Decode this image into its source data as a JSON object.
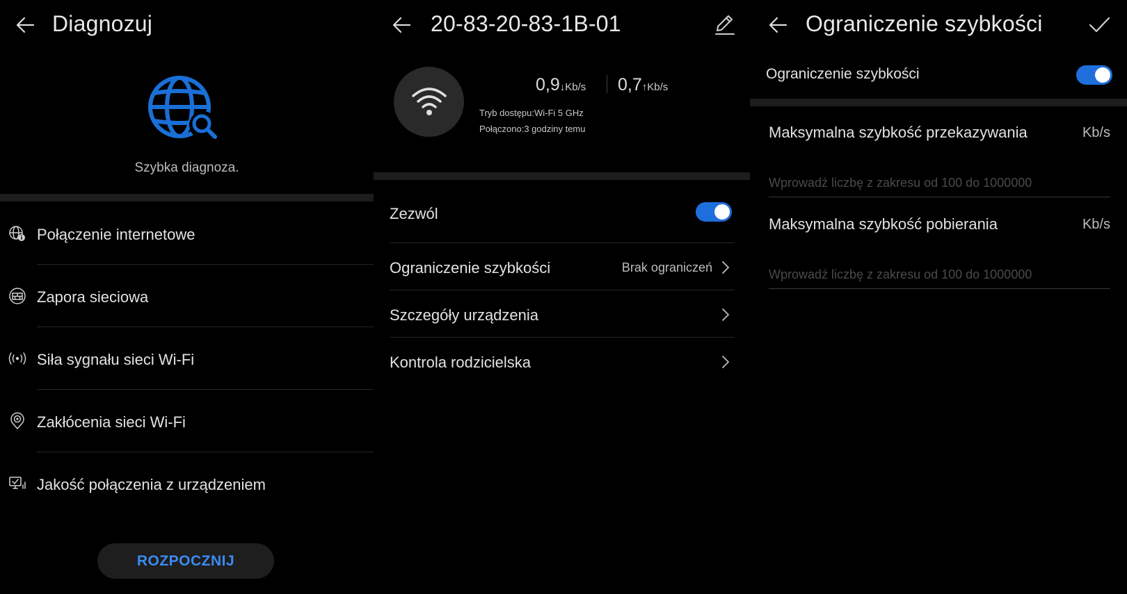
{
  "panel1": {
    "title": "Diagnozuj",
    "subtitle": "Szybka diagnoza.",
    "items": [
      {
        "label": "Połączenie internetowe",
        "icon": "globe-info-icon"
      },
      {
        "label": "Zapora sieciowa",
        "icon": "firewall-icon"
      },
      {
        "label": "Siła sygnału sieci Wi-Fi",
        "icon": "signal-strength-icon"
      },
      {
        "label": "Zakłócenia sieci Wi-Fi",
        "icon": "interference-icon"
      },
      {
        "label": "Jakość połączenia z urządzeniem",
        "icon": "device-quality-icon"
      }
    ],
    "start_button": "ROZPOCZNIJ",
    "accent": "#1a6fd6"
  },
  "panel2": {
    "title": "20-83-20-83-1B-01",
    "download_value": "0,9",
    "download_arrow": "↓",
    "download_unit": "Kb/s",
    "upload_value": "0,7",
    "upload_arrow": "↑",
    "upload_unit": "Kb/s",
    "access_mode": "Tryb dostępu:Wi-Fi 5 GHz",
    "connected": "Połączono:3 godziny temu",
    "allow_label": "Zezwól",
    "allow_on": true,
    "rows": [
      {
        "label": "Ograniczenie szybkości",
        "value": "Brak ograniczeń"
      },
      {
        "label": "Szczegóły urządzenia",
        "value": ""
      },
      {
        "label": "Kontrola rodzicielska",
        "value": ""
      }
    ],
    "toggle_color": "#1e6fdc"
  },
  "panel3": {
    "title": "Ograniczenie szybkości",
    "toggle_label": "Ograniczenie szybkości",
    "toggle_on": true,
    "upload_label": "Maksymalna szybkość przekazywania",
    "upload_unit": "Kb/s",
    "upload_placeholder": "Wprowadź liczbę z zakresu od 100 do 1000000",
    "download_label": "Maksymalna szybkość pobierania",
    "download_unit": "Kb/s",
    "download_placeholder": "Wprowadź liczbę z zakresu od 100 do 1000000"
  }
}
